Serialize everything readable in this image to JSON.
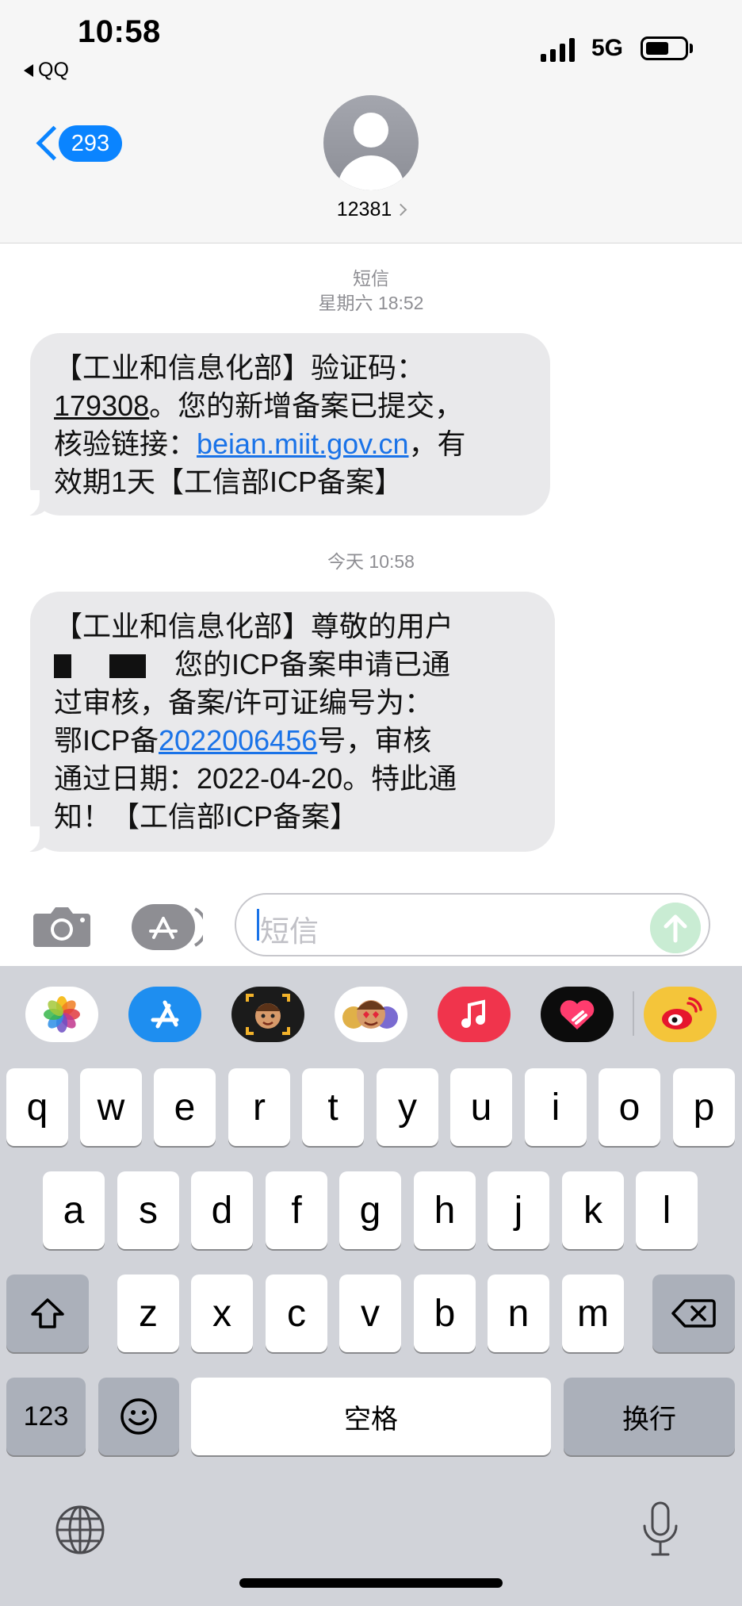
{
  "status_bar": {
    "time": "10:58",
    "back_app": "QQ",
    "network": "5G"
  },
  "header": {
    "back_count": "293",
    "contact": "12381"
  },
  "messages": [
    {
      "date_label": "短信",
      "timestamp": "星期六 18:52",
      "lines": [
        [
          "【工业和信息化部】验证码："
        ],
        [
          "179308",
          "。您的新增备案已提交，"
        ],
        [
          "核验链接：",
          "beian.miit.gov.cn",
          "，有"
        ],
        [
          "效期1天【工信部ICP备案】"
        ]
      ]
    },
    {
      "timestamp": "今天 10:58",
      "lines": [
        [
          "【工业和信息化部】尊敬的用户"
        ],
        [
          "您的ICP备案申请已通"
        ],
        [
          "过审核，备案/许可证编号为："
        ],
        [
          "鄂ICP备",
          "2022006456",
          "号，审核"
        ],
        [
          "通过日期：2022-04-20。特此通"
        ],
        [
          "知！【工信部ICP备案】"
        ]
      ]
    }
  ],
  "input": {
    "placeholder": "短信"
  },
  "app_strip": [
    "photos-icon",
    "app-store-icon",
    "memoji-icon",
    "animoji-icon",
    "music-icon",
    "digital-touch-icon",
    "weibo-icon"
  ],
  "keyboard": {
    "row1": [
      "q",
      "w",
      "e",
      "r",
      "t",
      "y",
      "u",
      "i",
      "o",
      "p"
    ],
    "row2": [
      "a",
      "s",
      "d",
      "f",
      "g",
      "h",
      "j",
      "k",
      "l"
    ],
    "row3": [
      "z",
      "x",
      "c",
      "v",
      "b",
      "n",
      "m"
    ],
    "numbers": "123",
    "space": "空格",
    "return": "换行"
  },
  "colors": {
    "accent": "#0a84ff",
    "link": "#1a73e8",
    "bubble": "#e9e9eb",
    "keyboard_bg": "#d1d3d9"
  }
}
